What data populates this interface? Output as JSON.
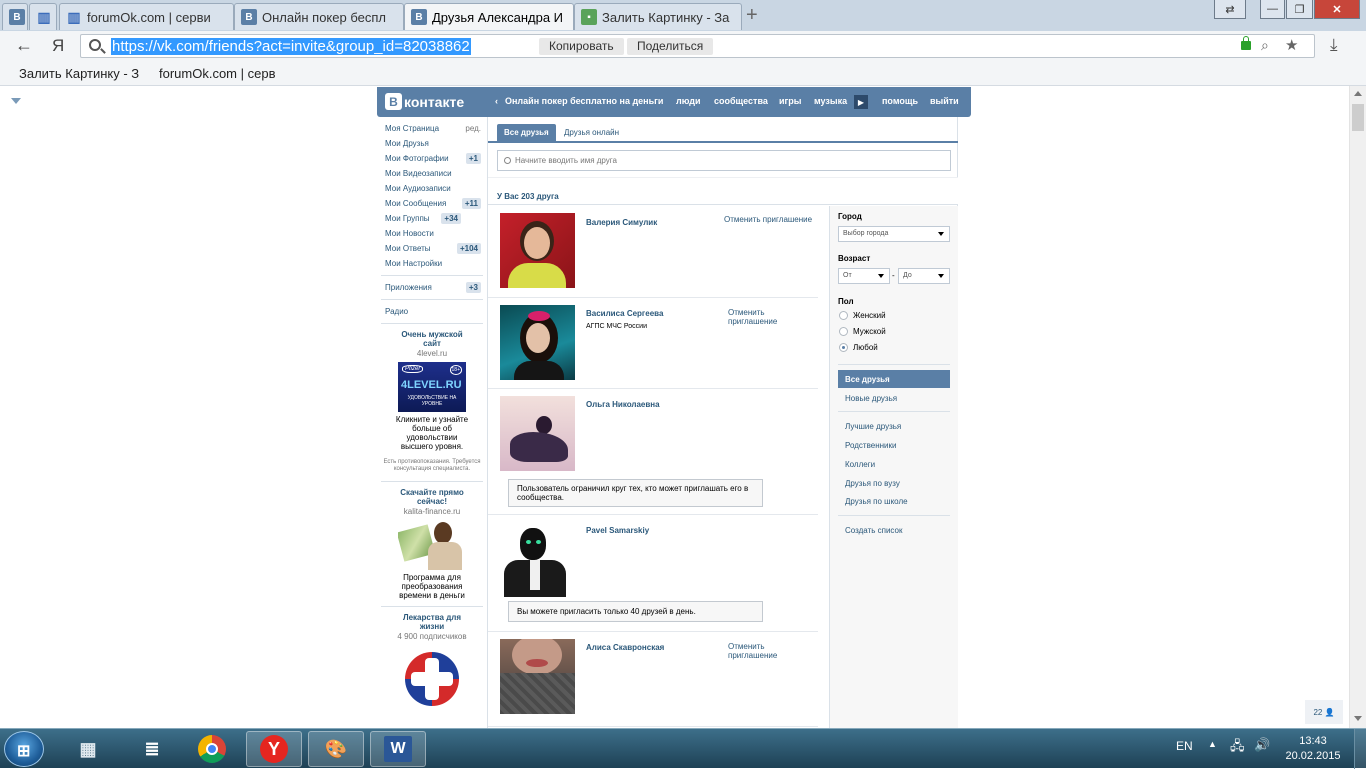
{
  "browser": {
    "tabs": [
      {
        "icon": "vk",
        "title": ""
      },
      {
        "icon": "bars",
        "title": ""
      },
      {
        "icon": "bars",
        "title": "forumOk.com | серви"
      },
      {
        "icon": "vk",
        "title": "Онлайн покер беспл"
      },
      {
        "icon": "vk",
        "title": "Друзья Александра И"
      },
      {
        "icon": "img",
        "title": "Залить Картинку - За"
      }
    ],
    "new_tab": "+",
    "address": {
      "yandex": "Я",
      "url": "https://vk.com/friends?act=invite&group_id=82038862",
      "copy": "Копировать",
      "share": "Поделиться"
    },
    "bookmarks": [
      "Залить Картинку - З",
      "forumOk.com | серв"
    ]
  },
  "vk": {
    "logo": "контакте",
    "logo_b": "В",
    "header_game": "Онлайн покер бесплатно на деньги",
    "nav": [
      "люди",
      "сообщества",
      "игры",
      "музыка",
      "помощь",
      "выйти"
    ],
    "left_menu": [
      {
        "label": "Моя Страница",
        "count": "ред."
      },
      {
        "label": "Мои Друзья",
        "count": ""
      },
      {
        "label": "Мои Фотографии",
        "count": "+1"
      },
      {
        "label": "Мои Видеозаписи",
        "count": ""
      },
      {
        "label": "Мои Аудиозаписи",
        "count": ""
      },
      {
        "label": "Мои Сообщения",
        "count": "+11"
      },
      {
        "label": "Мои Группы",
        "count": "+34"
      },
      {
        "label": "Мои Новости",
        "count": ""
      },
      {
        "label": "Мои Ответы",
        "count": "+104"
      },
      {
        "label": "Мои Настройки",
        "count": ""
      }
    ],
    "apps": {
      "label": "Приложения",
      "count": "+3"
    },
    "radio": "Радио",
    "ads": [
      {
        "title": "Очень мужской сайт",
        "site": "4level.ru",
        "img_text": "4LEVEL.RU",
        "img_sub": "УДОВОЛЬСТВИЕ НА УРОВНЕ",
        "img_brand": "Pfizer",
        "img_age": "18+",
        "desc": "Кликните и узнайте больше об удовольствии высшего уровня.",
        "warn": "Есть противопоказания. Требуется консультация специалиста."
      },
      {
        "title": "Скачайте прямо сейчас!",
        "site": "kalita-finance.ru",
        "desc": "Программа для преобразования времени в деньги"
      },
      {
        "title": "Лекарства для жизни",
        "site": "4 900 подписчиков"
      }
    ],
    "tabs": {
      "all": "Все друзья",
      "online": "Друзья онлайн"
    },
    "search_placeholder": "Начните вводить имя друга",
    "count_text": "У Вас 203 друга",
    "friends": [
      {
        "name": "Валерия Симулик",
        "sub": "",
        "action": "Отменить приглашение",
        "notice": ""
      },
      {
        "name": "Василиса Сергеева",
        "sub": "АГПС МЧС России",
        "action": "Отменить приглашение",
        "notice": ""
      },
      {
        "name": "Ольга Николаевна",
        "sub": "",
        "action": "",
        "notice": "Пользователь ограничил круг тех, кто может приглашать его в сообщества."
      },
      {
        "name": "Pavel Samarskiy",
        "sub": "",
        "action": "",
        "notice": "Вы можете пригласить только 40 друзей в день."
      },
      {
        "name": "Алиса Скавронская",
        "sub": "",
        "action": "Отменить приглашение",
        "notice": ""
      }
    ],
    "filters": {
      "city_label": "Город",
      "city_value": "Выбор города",
      "age_label": "Возраст",
      "age_from": "От",
      "age_dash": "-",
      "age_to": "До",
      "sex_label": "Пол",
      "sex_options": [
        "Женский",
        "Мужской",
        "Любой"
      ],
      "sex_selected": "Любой"
    },
    "right_menu": [
      "Все друзья",
      "Новые друзья",
      "Лучшие друзья",
      "Родственники",
      "Коллеги",
      "Друзья по вузу",
      "Друзья по школе",
      "Создать список"
    ],
    "corner_badge": "22 👤"
  },
  "taskbar": {
    "lang": "EN",
    "time": "13:43",
    "date": "20.02.2015"
  },
  "colors": {
    "vk_blue": "#5a7fa6",
    "link": "#2b587a",
    "selection": "#3399ff"
  }
}
